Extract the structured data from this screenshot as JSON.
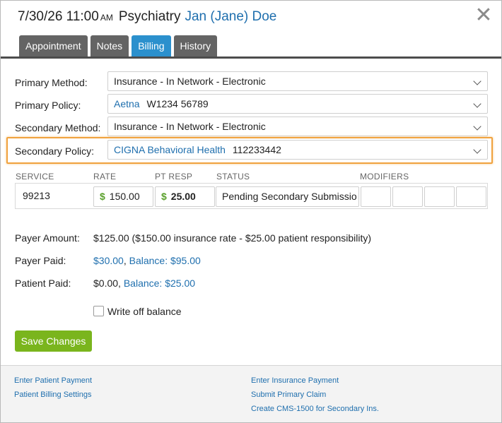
{
  "header": {
    "date_time": "7/30/26 11:00",
    "ampm": "AM",
    "appointment_type": "Psychiatry",
    "patient_name": "Jan (Jane) Doe",
    "close_glyph": "✕"
  },
  "tabs": [
    {
      "label": "Appointment",
      "active": false
    },
    {
      "label": "Notes",
      "active": false
    },
    {
      "label": "Billing",
      "active": true
    },
    {
      "label": "History",
      "active": false
    }
  ],
  "form": {
    "primary_method": {
      "label": "Primary Method:",
      "value": "Insurance - In Network - Electronic"
    },
    "primary_policy": {
      "label": "Primary Policy:",
      "insurer": "Aetna",
      "policy_number": "W1234 56789"
    },
    "secondary_method": {
      "label": "Secondary Method:",
      "value": "Insurance - In Network - Electronic"
    },
    "secondary_policy": {
      "label": "Secondary Policy:",
      "insurer": "CIGNA Behavioral Health",
      "policy_number": "112233442"
    }
  },
  "service_table": {
    "headers": {
      "service": "SERVICE",
      "rate": "RATE",
      "pt_resp": "PT RESP",
      "status": "STATUS",
      "modifiers": "MODIFIERS"
    },
    "row": {
      "service": "99213",
      "currency": "$",
      "rate": "150.00",
      "pt_resp": "25.00",
      "status": "Pending Secondary Submissio",
      "modifiers": [
        "",
        "",
        "",
        ""
      ]
    }
  },
  "summary": {
    "payer_amount_label": "Payer Amount:",
    "payer_amount_value": "$125.00 ($150.00 insurance rate - $25.00 patient responsibility)",
    "payer_paid_label": "Payer Paid:",
    "payer_paid_amount": "$30.00",
    "payer_paid_separator": ", ",
    "payer_balance": "Balance: $95.00",
    "patient_paid_label": "Patient Paid:",
    "patient_paid_amount": "$0.00,",
    "patient_balance": "Balance: $25.00"
  },
  "write_off": {
    "label": "Write off balance",
    "checked": false
  },
  "save_button": "Save Changes",
  "footer_links": {
    "enter_patient_payment": "Enter Patient Payment",
    "patient_billing_settings": "Patient Billing Settings",
    "enter_insurance_payment": "Enter Insurance Payment",
    "submit_primary_claim": "Submit Primary Claim",
    "create_cms_1500": "Create CMS-1500 for Secondary Ins."
  },
  "colors": {
    "link": "#1f6fae",
    "active_tab": "#2b90cd",
    "inactive_tab": "#646464",
    "save_button": "#7ab51d",
    "highlight": "#f0a23e",
    "dollar_sign": "#5aa02c"
  }
}
